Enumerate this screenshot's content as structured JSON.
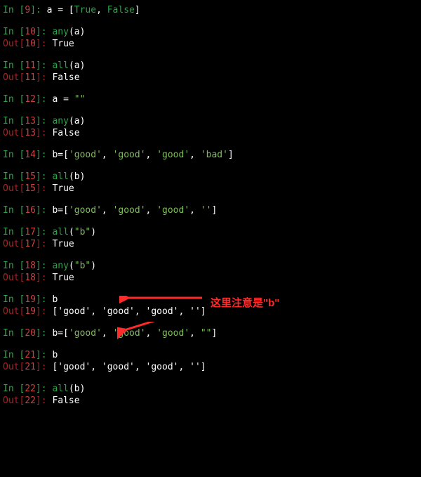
{
  "cells": [
    {
      "in_num": "9",
      "code_raw": "a = [True, False]",
      "out": null
    },
    {
      "in_num": "10",
      "fn": "any",
      "args": "a",
      "out": "True"
    },
    {
      "in_num": "11",
      "fn": "all",
      "args": "a",
      "out": "False"
    },
    {
      "in_num": "12",
      "code_raw": "a = \"\"",
      "out": null
    },
    {
      "in_num": "13",
      "fn": "any",
      "args": "a",
      "out": "False"
    },
    {
      "in_num": "14",
      "assign": "b",
      "list": [
        "'good'",
        "'good'",
        "'good'",
        "'bad'"
      ],
      "out": null
    },
    {
      "in_num": "15",
      "fn": "all",
      "args": "b",
      "out": "True"
    },
    {
      "in_num": "16",
      "assign": "b",
      "list": [
        "'good'",
        "'good'",
        "'good'",
        "''"
      ],
      "out": null
    },
    {
      "in_num": "17",
      "fn": "all",
      "args_str": "\"b\"",
      "out": "True"
    },
    {
      "in_num": "18",
      "fn": "any",
      "args_str": "\"b\"",
      "out": "True"
    },
    {
      "in_num": "19",
      "code_raw": "b",
      "out": "['good', 'good', 'good', '']"
    },
    {
      "in_num": "20",
      "assign": "b",
      "list": [
        "'good'",
        "'good'",
        "'good'",
        "\"\""
      ],
      "out": null
    },
    {
      "in_num": "21",
      "code_raw": "b",
      "out": "['good', 'good', 'good', '']"
    },
    {
      "in_num": "22",
      "fn": "all",
      "args": "b",
      "out": "False"
    }
  ],
  "labels": {
    "in_prefix": "In [",
    "in_suffix": "]: ",
    "out_prefix": "Out[",
    "out_suffix": "]: "
  },
  "annotation": {
    "text": "这里注意是\"b\"",
    "arrow_color": "#ff2a2a"
  }
}
